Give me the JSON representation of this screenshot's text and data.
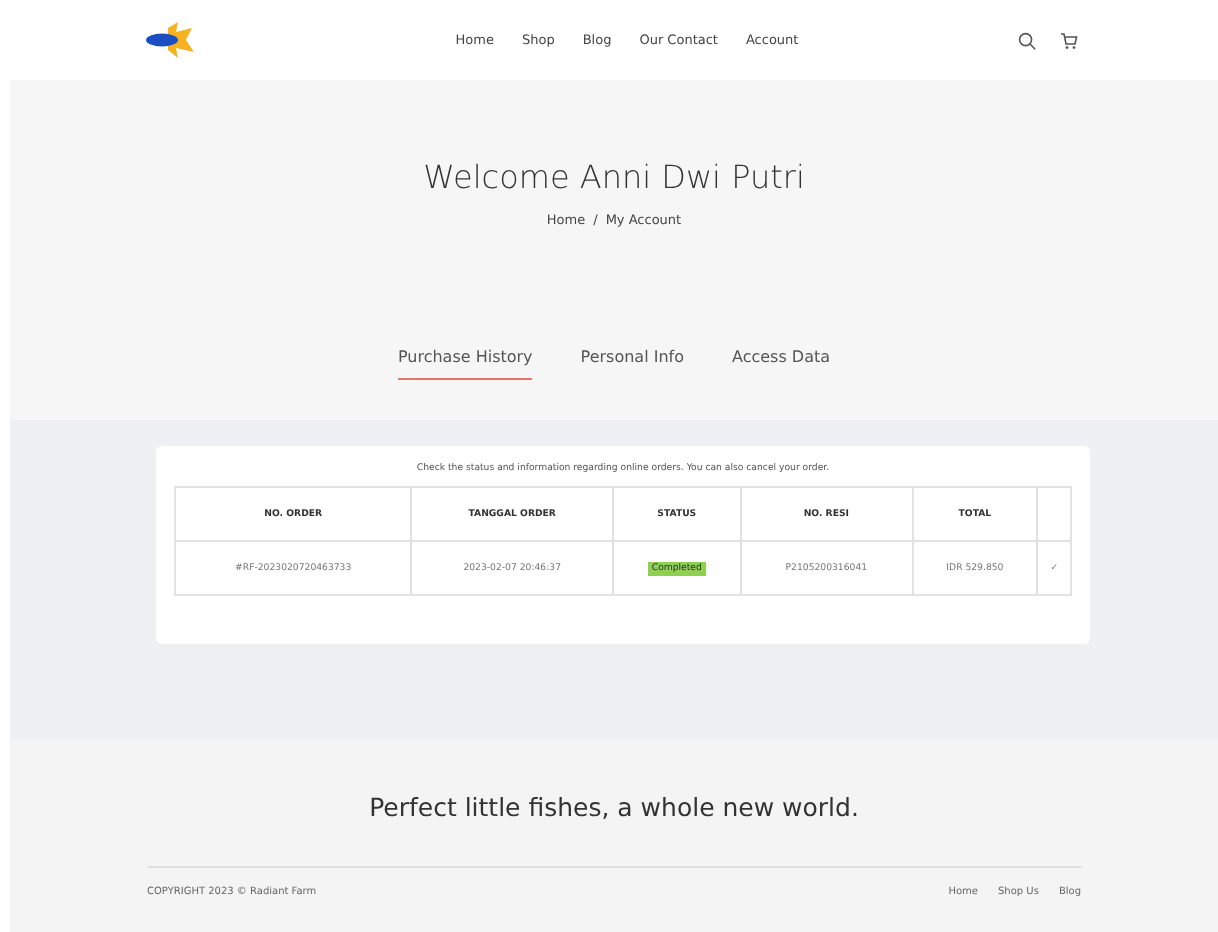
{
  "nav": {
    "links": [
      "Home",
      "Shop",
      "Blog",
      "Our Contact",
      "Account"
    ]
  },
  "hero": {
    "title": "Welcome Anni Dwi Putri",
    "breadcrumb": [
      "Home",
      "My Account"
    ],
    "separator": "/"
  },
  "tabs": [
    {
      "label": "Purchase History",
      "selected": true
    },
    {
      "label": "Personal Info",
      "selected": false
    },
    {
      "label": "Access Data",
      "selected": false
    }
  ],
  "orders": {
    "note": "Check the status and information regarding online orders. You can also cancel your order.",
    "columns": [
      "NO. ORDER",
      "TANGGAL ORDER",
      "STATUS",
      "NO. RESI",
      "TOTAL"
    ],
    "rows": [
      {
        "order": "#RF-2023020720463733",
        "date": "2023-02-07 20:46:37",
        "status": "Completed",
        "resi": "P2105200316041",
        "total": "IDR 529.850",
        "action": "✓"
      }
    ]
  },
  "footer": {
    "tagline": "Perfect little fishes, a whole new world.",
    "copyright": "COPYRIGHT 2023 © Radiant Farm",
    "links": [
      "Home",
      "Shop Us",
      "Blog"
    ]
  }
}
